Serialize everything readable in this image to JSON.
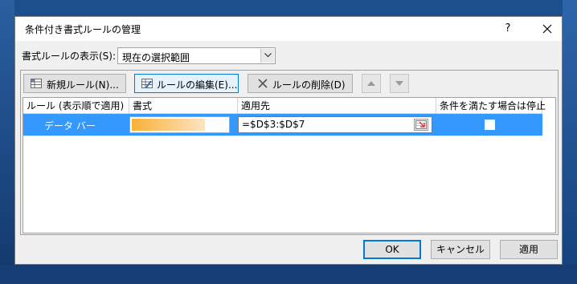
{
  "dialog": {
    "title": "条件付き書式ルールの管理",
    "help": "?",
    "close_icon": "close-icon"
  },
  "show": {
    "label": "書式ルールの表示(S):",
    "value": "現在の選択範囲"
  },
  "toolbar": {
    "new_rule": "新規ルール(N)...",
    "edit_rule": "ルールの編集(E)...",
    "delete_rule": "ルールの削除(D)",
    "move_up_icon": "triangle-up-icon",
    "move_down_icon": "triangle-down-icon"
  },
  "table": {
    "headers": [
      "ルール (表示順で適用)",
      "書式",
      "適用先",
      "条件を満たす場合は停止"
    ],
    "rows": [
      {
        "rule": "データ バー",
        "applies_to": "=$D$3:$D$7",
        "stop_if_true": false
      }
    ],
    "selected_color": "#3399ff",
    "bar_gradient": [
      "#f8b136",
      "#fde4c4"
    ]
  },
  "buttons": {
    "ok": "OK",
    "cancel": "キャンセル",
    "apply": "適用"
  }
}
